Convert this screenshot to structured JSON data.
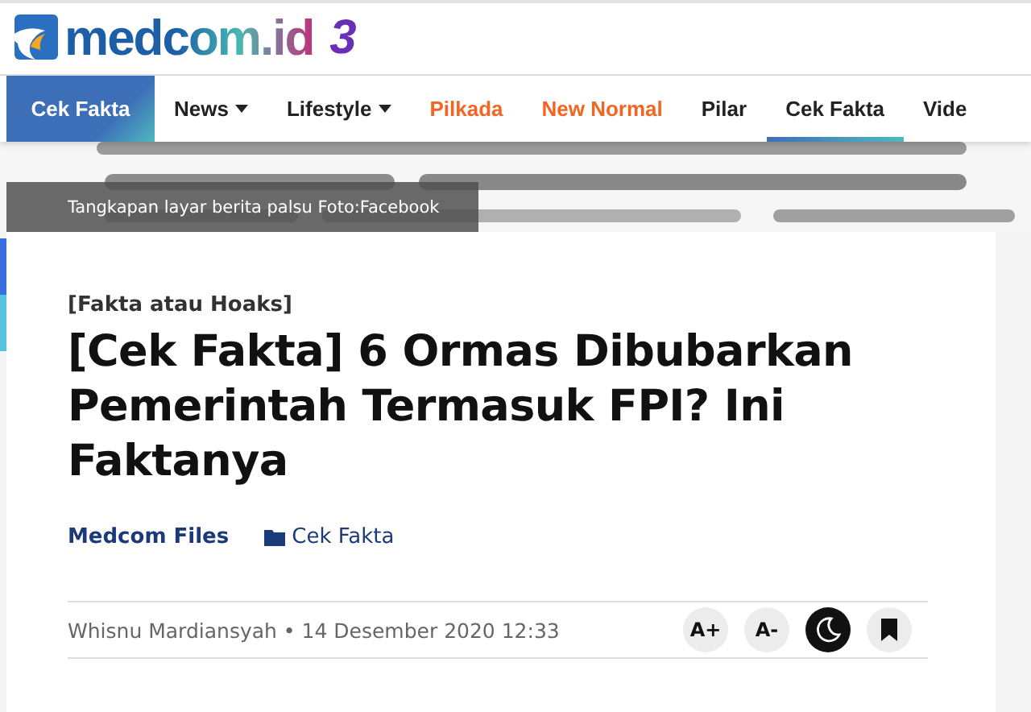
{
  "logo": {
    "text": "medcom.id",
    "badge": "3"
  },
  "nav": {
    "section": "Cek Fakta",
    "items": [
      {
        "label": "News",
        "has_menu": true,
        "color": "#222222",
        "selected": false
      },
      {
        "label": "Lifestyle",
        "has_menu": true,
        "color": "#222222",
        "selected": false
      },
      {
        "label": "Pilkada",
        "has_menu": false,
        "color": "#f26522",
        "selected": false
      },
      {
        "label": "New Normal",
        "has_menu": false,
        "color": "#f26522",
        "selected": false
      },
      {
        "label": "Pilar",
        "has_menu": false,
        "color": "#222222",
        "selected": false
      },
      {
        "label": "Cek Fakta",
        "has_menu": false,
        "color": "#222222",
        "selected": true
      },
      {
        "label": "Vide",
        "has_menu": false,
        "color": "#222222",
        "selected": false
      }
    ]
  },
  "image": {
    "kind": "picture",
    "caption": "Tangkapan layar berita palsu Foto:Facebook"
  },
  "article": {
    "category": "[Fakta atau Hoaks]",
    "title": "[Cek Fakta] 6 Ormas Dibubarkan Pemerintah Termasuk FPI? Ini Faktanya",
    "source": "Medcom Files",
    "channel": "Cek Fakta",
    "byline": "Whisnu Mardiansyah • 14 Desember 2020 12:33",
    "tools": [
      {
        "kind": "text",
        "label": "A+"
      },
      {
        "kind": "text",
        "label": "A-"
      },
      {
        "kind": "dark"
      },
      {
        "kind": "bookmark"
      }
    ]
  }
}
